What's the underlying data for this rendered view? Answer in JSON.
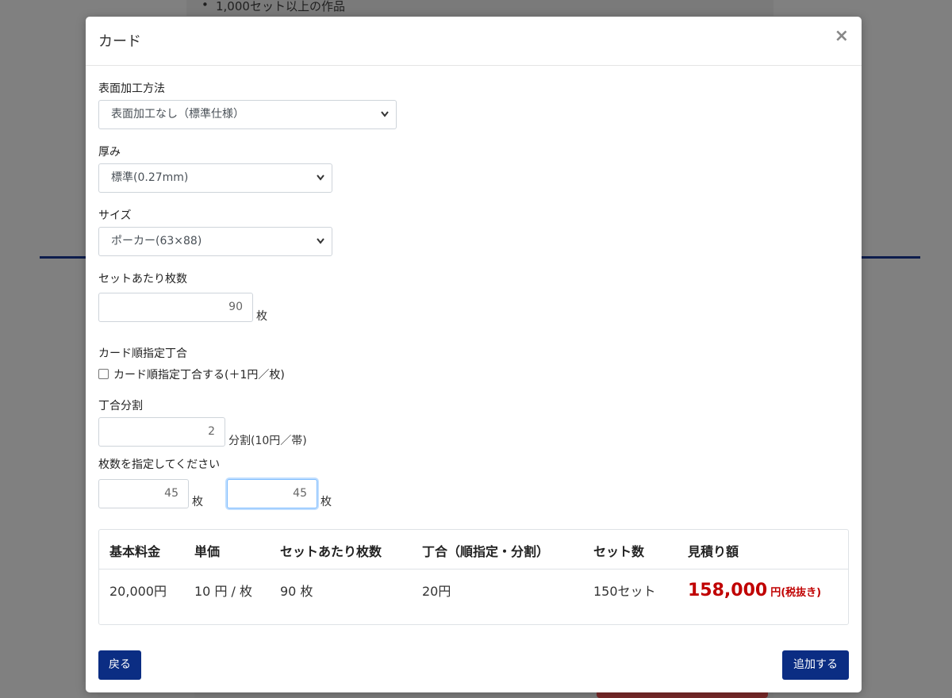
{
  "background": {
    "list_item": "1,000セット以上の作品"
  },
  "modal": {
    "title": "カード",
    "close_label": "×",
    "surface": {
      "label": "表面加工方法",
      "selected": "表面加工なし（標準仕様）"
    },
    "thickness": {
      "label": "厚み",
      "selected": "標準(0.27mm)"
    },
    "size": {
      "label": "サイズ",
      "selected": "ポーカー(63×88)"
    },
    "cards_per_set": {
      "label": "セットあたり枚数",
      "value": "90",
      "unit": "枚"
    },
    "order_collation": {
      "label": "カード順指定丁合",
      "checkbox_label": "カード順指定丁合する(＋1円／枚)",
      "checked": false
    },
    "split": {
      "label": "丁合分割",
      "value": "2",
      "unit": "分割(10円／帯)"
    },
    "split_counts": {
      "label": "枚数を指定してください",
      "first_value": "45",
      "second_value": "45",
      "unit": "枚"
    },
    "summary": {
      "headers": [
        "基本料金",
        "単価",
        "セットあたり枚数",
        "丁合（順指定・分割）",
        "セット数",
        "見積り額"
      ],
      "row": [
        "20,000円",
        "10 円 / 枚",
        "90 枚",
        "20円",
        "150セット"
      ],
      "total": "158,000",
      "total_suffix": "円(税抜き)",
      "total_color": "#c00000"
    },
    "back_button": "戻る",
    "add_button": "追加する",
    "accent_color": "#0b2d83"
  }
}
